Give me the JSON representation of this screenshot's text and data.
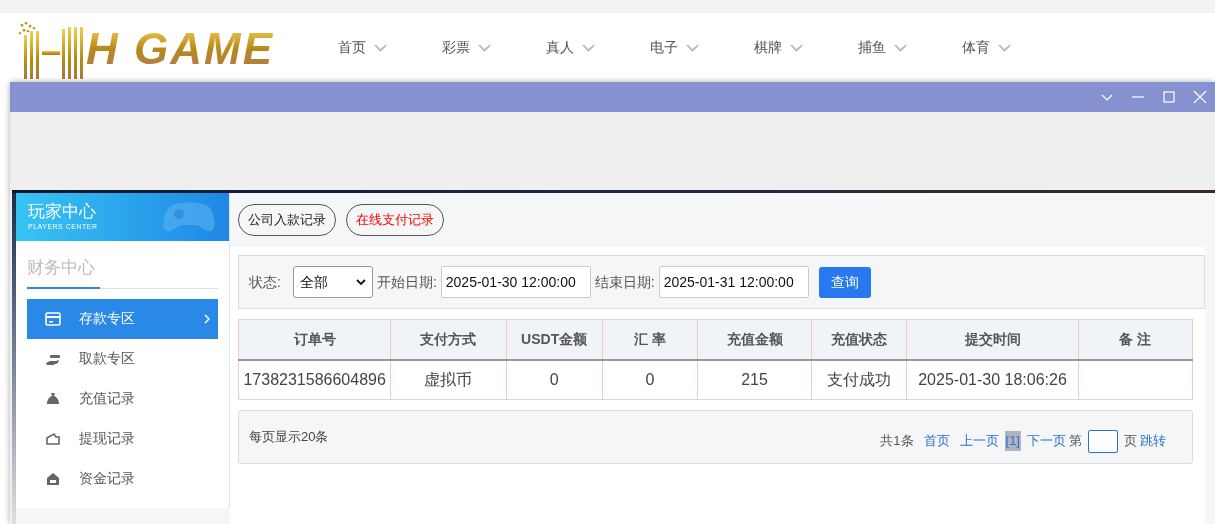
{
  "logo": {
    "text": "H GAME"
  },
  "nav": [
    {
      "label": "首页"
    },
    {
      "label": "彩票"
    },
    {
      "label": "真人"
    },
    {
      "label": "电子"
    },
    {
      "label": "棋牌"
    },
    {
      "label": "捕鱼"
    },
    {
      "label": "体育"
    }
  ],
  "sidebar": {
    "title": "玩家中心",
    "subtitle": "PLAYERS CENTER",
    "section": "财务中心",
    "items": [
      {
        "label": "存款专区",
        "selected": true
      },
      {
        "label": "取款专区",
        "selected": false
      },
      {
        "label": "充值记录",
        "selected": false
      },
      {
        "label": "提现记录",
        "selected": false
      },
      {
        "label": "资金记录",
        "selected": false
      }
    ]
  },
  "tabs": [
    {
      "label": "公司入款记录",
      "selected": false
    },
    {
      "label": "在线支付记录",
      "selected": true
    }
  ],
  "filter": {
    "status_label": "状态:",
    "status_value": "全部",
    "start_label": "开始日期:",
    "start_value": "2025-01-30 12:00:00",
    "end_label": "结束日期:",
    "end_value": "2025-01-31 12:00:00",
    "button": "查询"
  },
  "table": {
    "columns": [
      "订单号",
      "支付方式",
      "USDT金额",
      "汇 率",
      "充值金额",
      "充值状态",
      "提交时间",
      "备 注"
    ],
    "rows": [
      [
        "1738231586604896",
        "虚拟币",
        "0",
        "0",
        "215",
        "支付成功",
        "2025-01-30 18:06:26",
        ""
      ]
    ]
  },
  "pager": {
    "per_page": "每页显示20条",
    "total": "共1条",
    "first": "首页",
    "prev": "上一页",
    "current": "[1]",
    "next": "下一页",
    "goto_prefix": "第",
    "goto_suffix": "页",
    "goto": "跳转"
  }
}
